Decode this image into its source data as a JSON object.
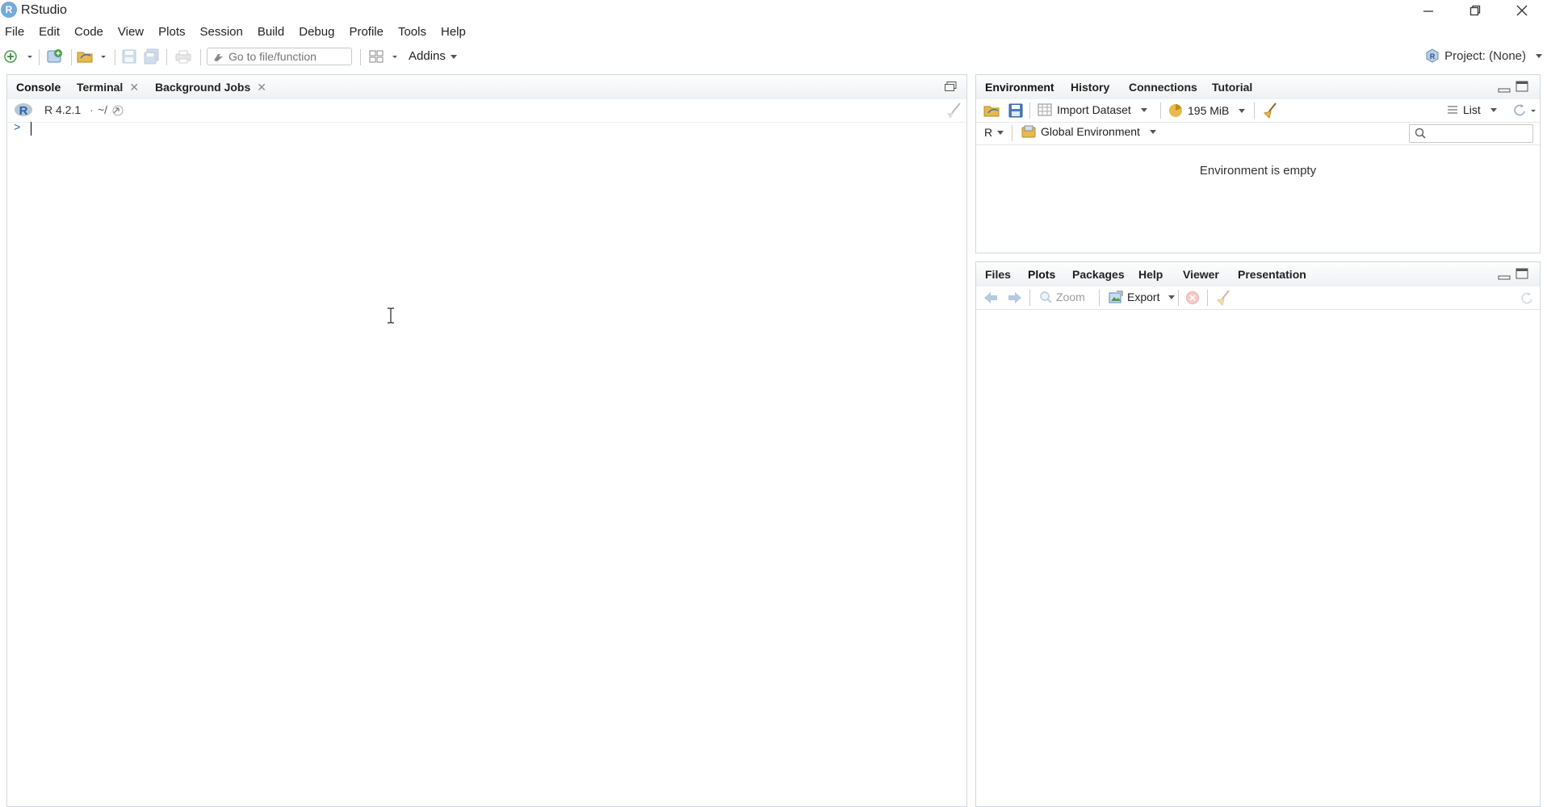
{
  "window": {
    "app_logo_letter": "R",
    "title": "RStudio"
  },
  "menu": [
    "File",
    "Edit",
    "Code",
    "View",
    "Plots",
    "Session",
    "Build",
    "Debug",
    "Profile",
    "Tools",
    "Help"
  ],
  "toolbar": {
    "goto_placeholder": "Go to file/function",
    "addins_label": "Addins",
    "project_label": "Project: (None)"
  },
  "console_pane": {
    "tabs": [
      "Console",
      "Terminal",
      "Background Jobs"
    ],
    "r_version": "R 4.2.1",
    "working_dir": "~/",
    "prompt": ">"
  },
  "env_pane": {
    "tabs": [
      "Environment",
      "History",
      "Connections",
      "Tutorial"
    ],
    "import_dataset_label": "Import Dataset",
    "memory_label": "195 MiB",
    "list_label": "List",
    "language_label": "R",
    "scope_label": "Global Environment",
    "empty_message": "Environment is empty"
  },
  "files_pane": {
    "tabs": [
      "Files",
      "Plots",
      "Packages",
      "Help",
      "Viewer",
      "Presentation"
    ],
    "zoom_label": "Zoom",
    "export_label": "Export"
  },
  "colors": {
    "r_blue": "#75AADB",
    "pane_border": "#d0d8e0",
    "folder_yellow": "#E8B94C",
    "save_blue": "#4A7DB5"
  }
}
